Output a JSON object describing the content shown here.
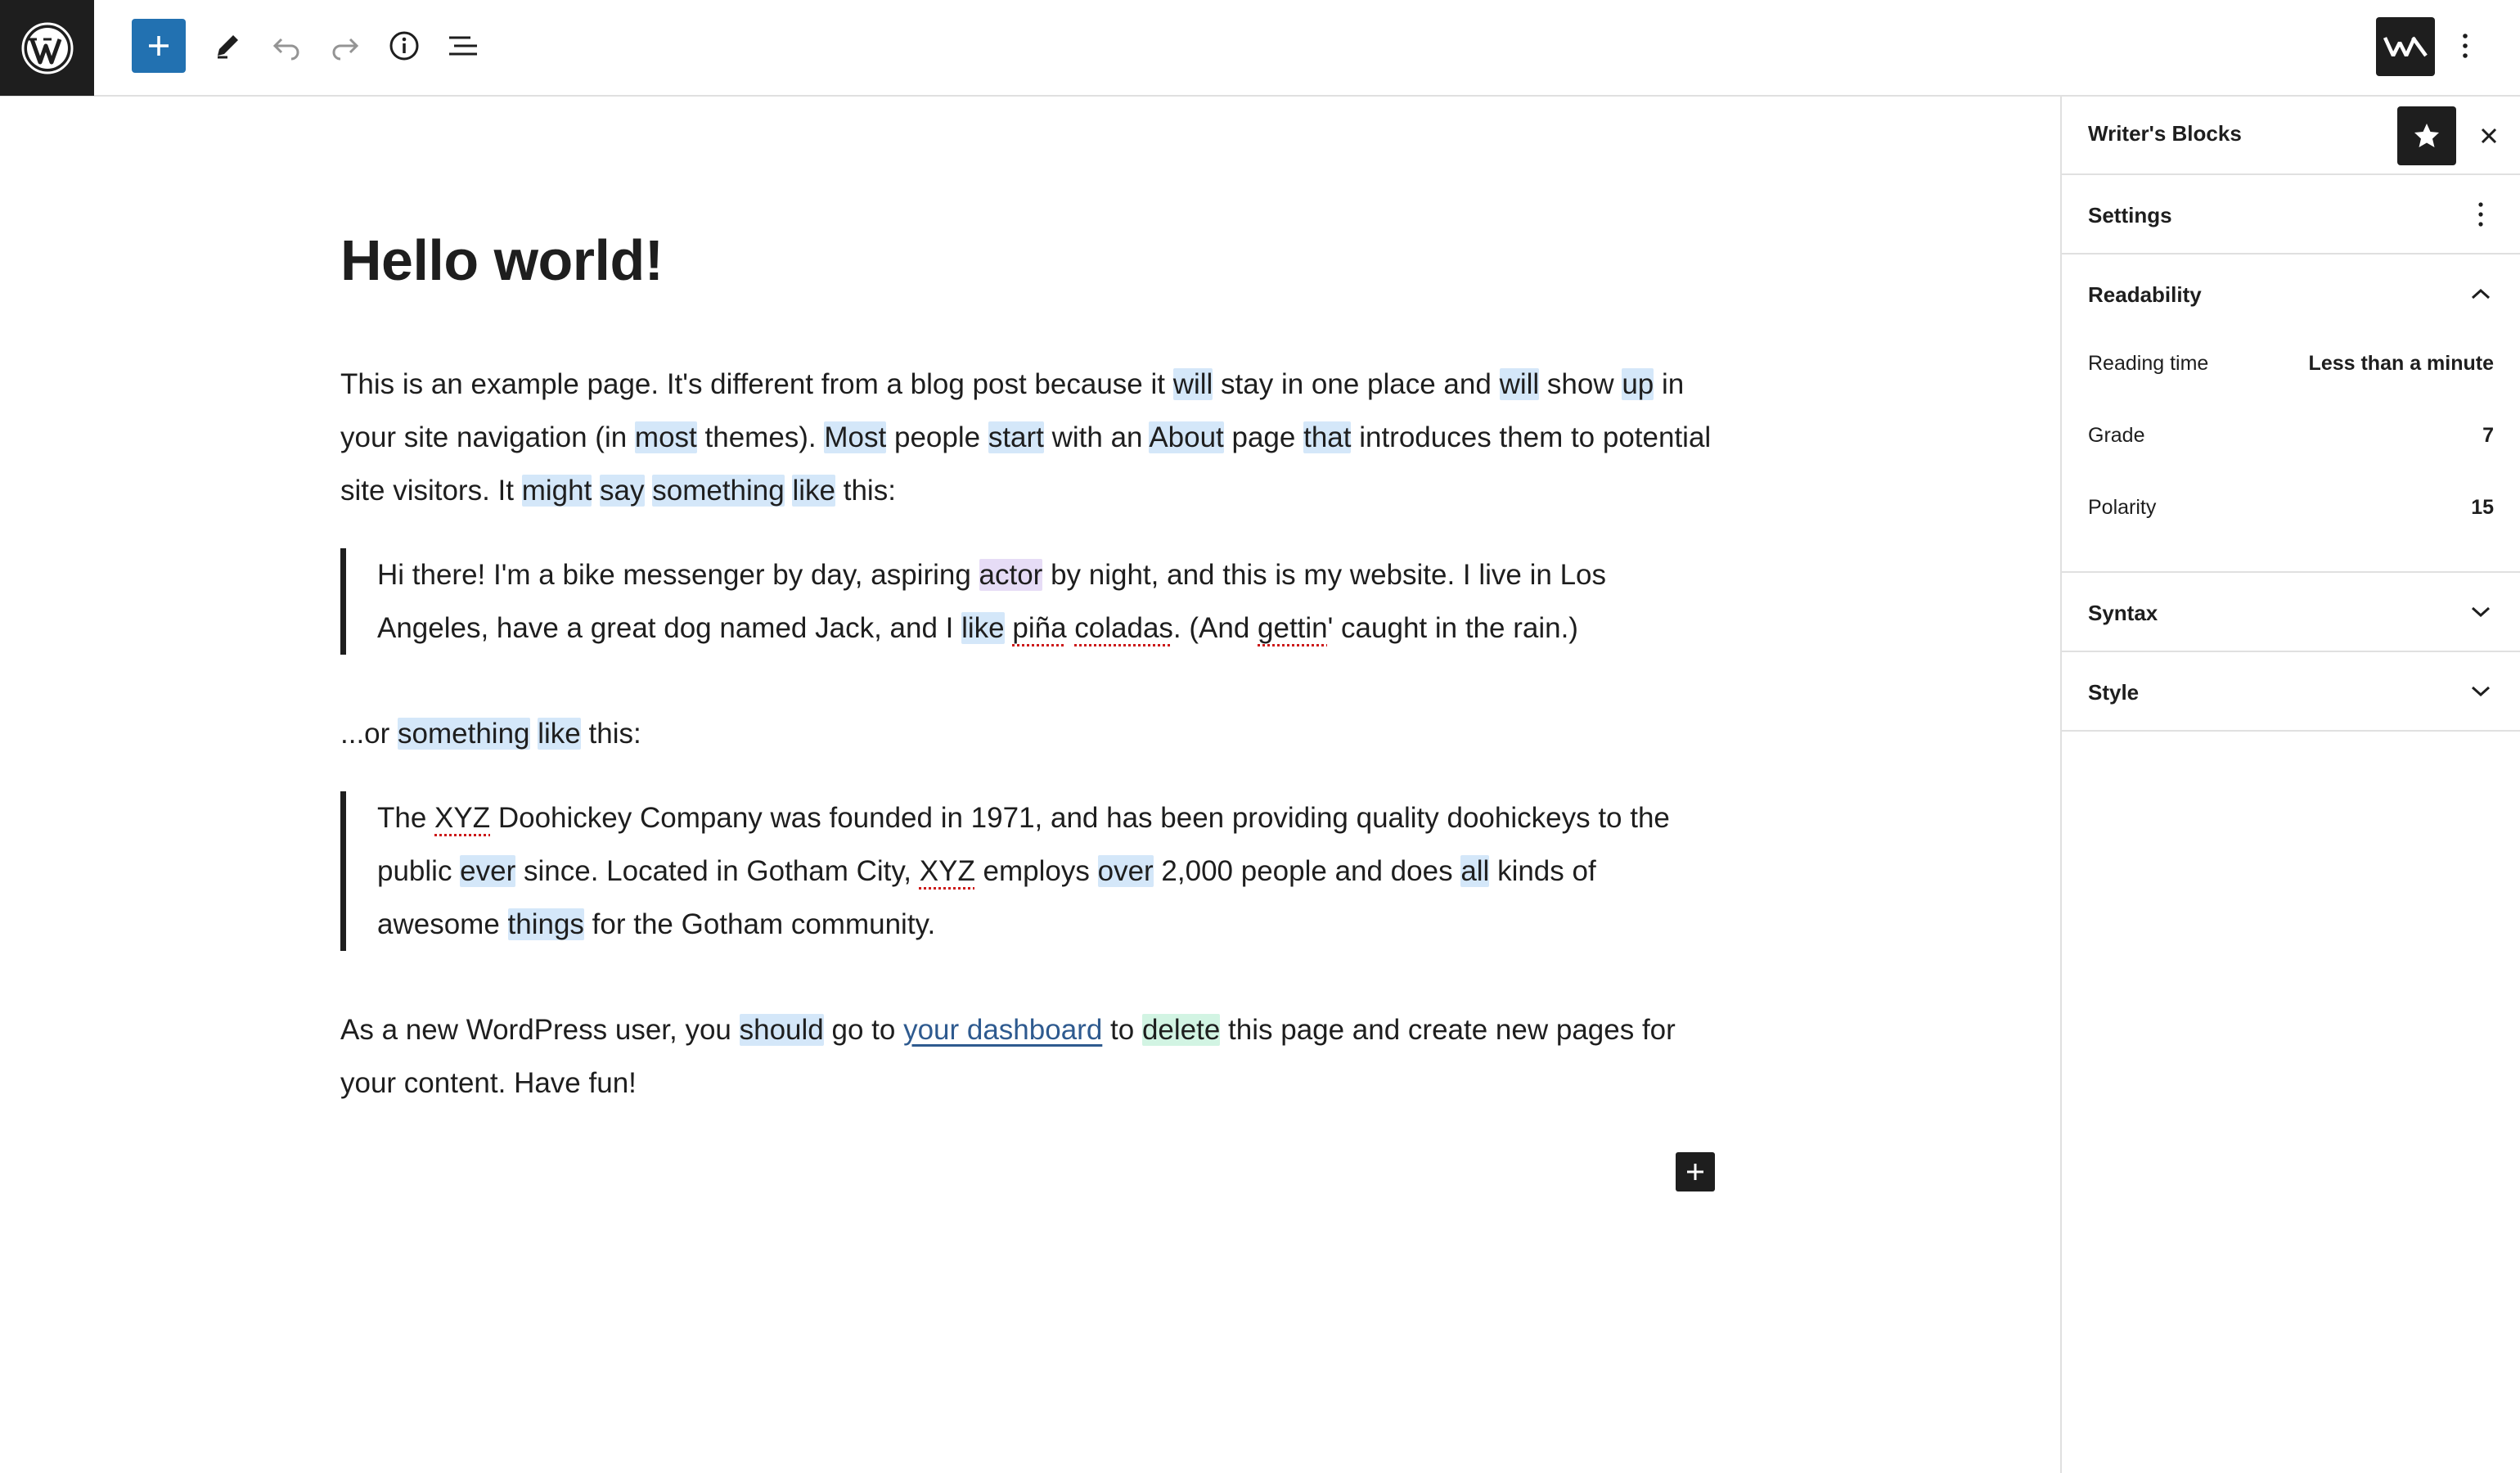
{
  "toolbar": {
    "add_block": "add-block",
    "tools": "edit-tools",
    "undo": "undo",
    "redo": "redo",
    "details": "details",
    "list_view": "list-view",
    "options": "options"
  },
  "post": {
    "title": "Hello world!",
    "p1": [
      {
        "t": "This is an example page. It's different from a blog post because it "
      },
      {
        "t": "will",
        "hl": "blue"
      },
      {
        "t": " stay in one place and "
      },
      {
        "t": "will",
        "hl": "blue"
      },
      {
        "t": " show "
      },
      {
        "t": "up",
        "hl": "blue"
      },
      {
        "t": " in your site navigation (in "
      },
      {
        "t": "most",
        "hl": "blue"
      },
      {
        "t": " themes). "
      },
      {
        "t": "Most",
        "hl": "blue"
      },
      {
        "t": " people "
      },
      {
        "t": "start",
        "hl": "blue"
      },
      {
        "t": " with an "
      },
      {
        "t": "About",
        "hl": "blue"
      },
      {
        "t": " page "
      },
      {
        "t": "that",
        "hl": "blue"
      },
      {
        "t": " introduces them to potential site visitors. It "
      },
      {
        "t": "might",
        "hl": "blue"
      },
      {
        "t": " "
      },
      {
        "t": "say",
        "hl": "blue"
      },
      {
        "t": " "
      },
      {
        "t": "something",
        "hl": "blue"
      },
      {
        "t": " "
      },
      {
        "t": "like",
        "hl": "blue"
      },
      {
        "t": " this:"
      }
    ],
    "quote1": [
      {
        "t": "Hi there! I'm a bike messenger by day, aspiring "
      },
      {
        "t": "actor",
        "hl": "purple"
      },
      {
        "t": " by night, and this is my website. I live in Los Angeles, have a great dog named Jack, and I "
      },
      {
        "t": "like",
        "hl": "blue"
      },
      {
        "t": " "
      },
      {
        "t": "piña",
        "spell": true
      },
      {
        "t": " "
      },
      {
        "t": "coladas",
        "spell": true
      },
      {
        "t": ". (And "
      },
      {
        "t": "gettin",
        "spell": true
      },
      {
        "t": "' caught in the rain.)"
      }
    ],
    "p2": [
      {
        "t": "...or "
      },
      {
        "t": "something",
        "hl": "blue"
      },
      {
        "t": " "
      },
      {
        "t": "like",
        "hl": "blue"
      },
      {
        "t": " this:"
      }
    ],
    "quote2": [
      {
        "t": "The "
      },
      {
        "t": "XYZ",
        "spell": true
      },
      {
        "t": " Doohickey Company was founded in 1971, and has been providing quality doohickeys to the public "
      },
      {
        "t": "ever",
        "hl": "blue"
      },
      {
        "t": " since. Located in Gotham City, "
      },
      {
        "t": "XYZ",
        "spell": true
      },
      {
        "t": " employs "
      },
      {
        "t": "over",
        "hl": "blue"
      },
      {
        "t": " 2,000 people and does "
      },
      {
        "t": "all",
        "hl": "blue"
      },
      {
        "t": " kinds of awesome "
      },
      {
        "t": "things",
        "hl": "blue"
      },
      {
        "t": " for the Gotham community."
      }
    ],
    "p3": [
      {
        "t": "As a new WordPress user, you "
      },
      {
        "t": "should",
        "hl": "blue"
      },
      {
        "t": " go to "
      },
      {
        "t": "your dashboard",
        "link": true
      },
      {
        "t": " to "
      },
      {
        "t": "delete",
        "hl": "green"
      },
      {
        "t": " this page and create new pages for your content. Have fun!"
      }
    ]
  },
  "sidebar": {
    "title": "Writer's Blocks",
    "settings": "Settings",
    "readability": "Readability",
    "metrics": [
      {
        "label": "Reading time",
        "value": "Less than a minute"
      },
      {
        "label": "Grade",
        "value": "7"
      },
      {
        "label": "Polarity",
        "value": "15"
      }
    ],
    "syntax": "Syntax",
    "style": "Style"
  },
  "colors": {
    "accent": "#2271b1",
    "highlight_blue": "#d4e7f9",
    "highlight_purple": "#e6dcf6",
    "highlight_green": "#d2f4e3",
    "dark": "#1e1e1e"
  }
}
